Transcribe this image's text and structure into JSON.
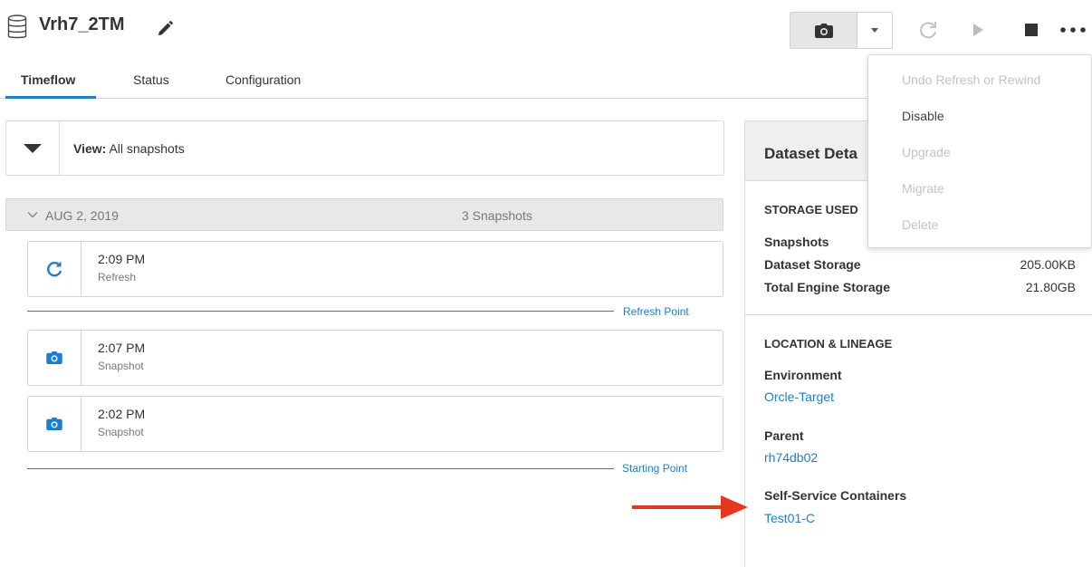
{
  "header": {
    "title": "Vrh7_2TM",
    "db_icon": "database-icon",
    "edit_icon": "pencil-icon"
  },
  "toolbar": {
    "snapshot_icon": "camera-icon",
    "caret_icon": "caret-down-icon",
    "refresh_icon": "refresh-icon",
    "start_icon": "play-icon",
    "stop_icon": "stop-icon",
    "more_icon": "more-horizontal-icon"
  },
  "tabs": [
    {
      "label": "Timeflow",
      "active": true
    },
    {
      "label": "Status",
      "active": false
    },
    {
      "label": "Configuration",
      "active": false
    }
  ],
  "view": {
    "label": "View:",
    "value": "All snapshots"
  },
  "timeline": {
    "date": "AUG 2, 2019",
    "count": "3 Snapshots",
    "items": [
      {
        "time": "2:09 PM",
        "type": "Refresh",
        "icon": "refresh-icon"
      },
      {
        "time": "2:07 PM",
        "type": "Snapshot",
        "icon": "camera-icon"
      },
      {
        "time": "2:02 PM",
        "type": "Snapshot",
        "icon": "camera-icon"
      }
    ],
    "refresh_point": "Refresh Point",
    "starting_point": "Starting Point"
  },
  "details": {
    "title": "Dataset Deta",
    "storage": {
      "title": "STORAGE USED",
      "rows": [
        {
          "label": "Snapshots",
          "value": ""
        },
        {
          "label": "Dataset Storage",
          "value": "205.00KB"
        },
        {
          "label": "Total Engine Storage",
          "value": "21.80GB"
        }
      ]
    },
    "location": {
      "title": "LOCATION & LINEAGE",
      "environment_label": "Environment",
      "environment_value": "Orcle-Target",
      "parent_label": "Parent",
      "parent_value": "rh74db02",
      "containers_label": "Self-Service Containers",
      "containers_value": "Test01-C"
    }
  },
  "menu": {
    "items": [
      {
        "label": "Undo Refresh or Rewind",
        "enabled": false
      },
      {
        "label": "Disable",
        "enabled": true
      },
      {
        "label": "Upgrade",
        "enabled": false
      },
      {
        "label": "Migrate",
        "enabled": false
      },
      {
        "label": "Delete",
        "enabled": false
      }
    ]
  },
  "colors": {
    "accent": "#1a7fd4",
    "arrow": "#e8361c"
  }
}
